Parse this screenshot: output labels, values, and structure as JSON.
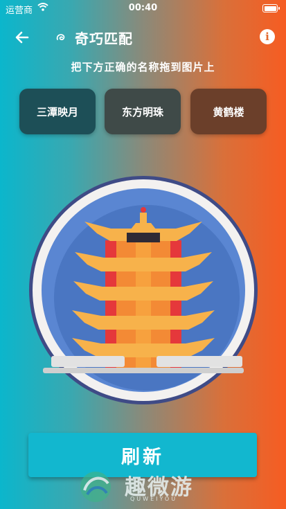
{
  "status_bar": {
    "carrier": "运营商",
    "time": "00:40"
  },
  "nav": {
    "title": "奇巧匹配"
  },
  "instruction": "把下方正确的名称拖到图片上",
  "options": [
    {
      "label": "三潭映月"
    },
    {
      "label": "东方明珠"
    },
    {
      "label": "黄鹤楼"
    }
  ],
  "picture": {
    "subject": "pagoda-tower-icon"
  },
  "refresh_button": {
    "label": "刷新"
  },
  "watermark": {
    "text": "趣微游",
    "sub": "QUWEIYOU"
  },
  "colors": {
    "gradient_left": "#0bb6cc",
    "gradient_right": "#f65c22",
    "button": "#12b7cf",
    "roof": "#f7b24b",
    "pillar": "#e5383b"
  }
}
